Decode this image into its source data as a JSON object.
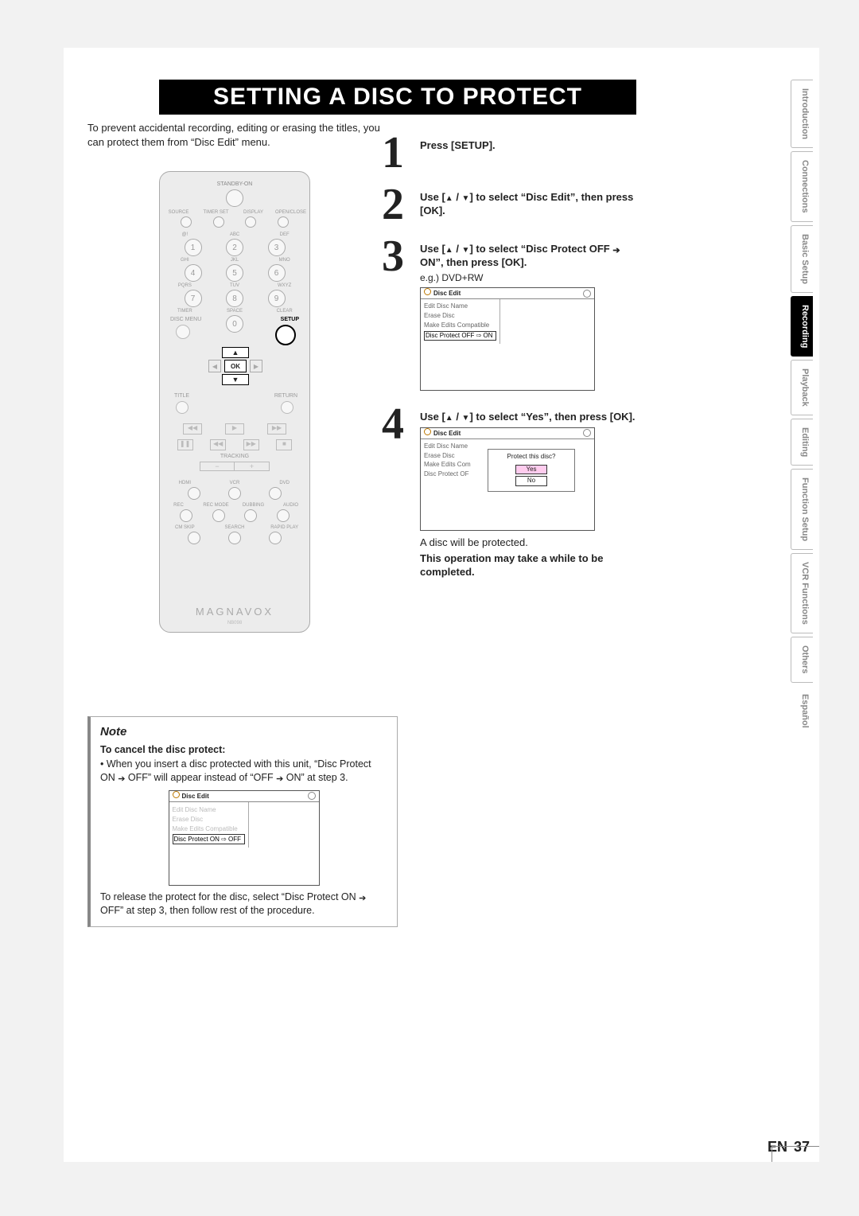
{
  "title": "SETTING A DISC TO PROTECT",
  "intro": "To prevent accidental recording, editing or erasing the titles, you can protect them from “Disc Edit” menu.",
  "remote": {
    "standby_label": "STANDBY-ON",
    "row2_labels": [
      "SOURCE",
      "TIMER SET",
      "DISPLAY",
      "OPEN/CLOSE"
    ],
    "keypad_top": [
      "@!",
      "ABC",
      "DEF"
    ],
    "keypad_nums": [
      "1",
      "2",
      "3",
      "4",
      "5",
      "6",
      "7",
      "8",
      "9",
      "0"
    ],
    "keypad_mid": [
      "GHI",
      "JKL",
      "MNO",
      "PQRS",
      "TUV",
      "WXYZ",
      "TIMER",
      "SPACE",
      "CLEAR"
    ],
    "disc_menu": "DISC MENU",
    "setup": "SETUP",
    "ok": "OK",
    "title_label": "TITLE",
    "return_label": "RETURN",
    "tracking": "TRACKING",
    "mode_row": [
      "HDMI",
      "VCR",
      "DVD"
    ],
    "rec_row": [
      "REC",
      "REC MODE",
      "DUBBING",
      "AUDIO"
    ],
    "cm_row": [
      "CM SKIP",
      "SEARCH",
      "RAPID PLAY"
    ],
    "brand": "MAGNAVOX",
    "model": "NB098"
  },
  "steps": {
    "s1_num": "1",
    "s1_text": "Press [SETUP].",
    "s2_num": "2",
    "s2_text_a": "Use [",
    "s2_text_b": " / ",
    "s2_text_c": "] to select “Disc Edit”, then press [OK].",
    "s3_num": "3",
    "s3_text_a": "Use [",
    "s3_text_b": " / ",
    "s3_text_c": "] to select “Disc Protect OFF ",
    "s3_text_d": " ON”, then press [OK].",
    "s3_eg": "e.g.) DVD+RW",
    "s4_num": "4",
    "s4_text_a": "Use [",
    "s4_text_b": " / ",
    "s4_text_c": "] to select “Yes”, then press [OK].",
    "s4_result": "A disc will be protected.",
    "s4_warn": "This operation may take a while to be completed."
  },
  "osd_a": {
    "title": "Disc Edit",
    "items": [
      "Edit Disc Name",
      "Erase Disc",
      "Make Edits Compatible"
    ],
    "selected": "Disc Protect OFF ⇨ ON"
  },
  "osd_b": {
    "title": "Disc Edit",
    "items": [
      "Edit Disc Name",
      "Erase Disc",
      "Make Edits Com",
      "Disc Protect OF"
    ],
    "dialog_q": "Protect this disc?",
    "yes": "Yes",
    "no": "No"
  },
  "note": {
    "title": "Note",
    "cancel_hdr": "To cancel the disc protect:",
    "bullet_a": "When you insert a disc protected with this unit, “Disc Protect ON ",
    "bullet_b": " OFF” will appear instead of “OFF ",
    "bullet_c": " ON” at step 3.",
    "release_a": "To release the protect for the disc, select “Disc Protect ON ",
    "release_b": " OFF” at step 3, then follow rest of the procedure."
  },
  "osd_c": {
    "title": "Disc Edit",
    "items": [
      "Edit Disc Name",
      "Erase Disc",
      "Make Edits Compatible"
    ],
    "selected": "Disc Protect ON ⇨ OFF"
  },
  "tabs": [
    "Introduction",
    "Connections",
    "Basic Setup",
    "Recording",
    "Playback",
    "Editing",
    "Function Setup",
    "VCR Functions",
    "Others",
    "Español"
  ],
  "active_tab_index": 3,
  "page_lang": "EN",
  "page_num": "37"
}
